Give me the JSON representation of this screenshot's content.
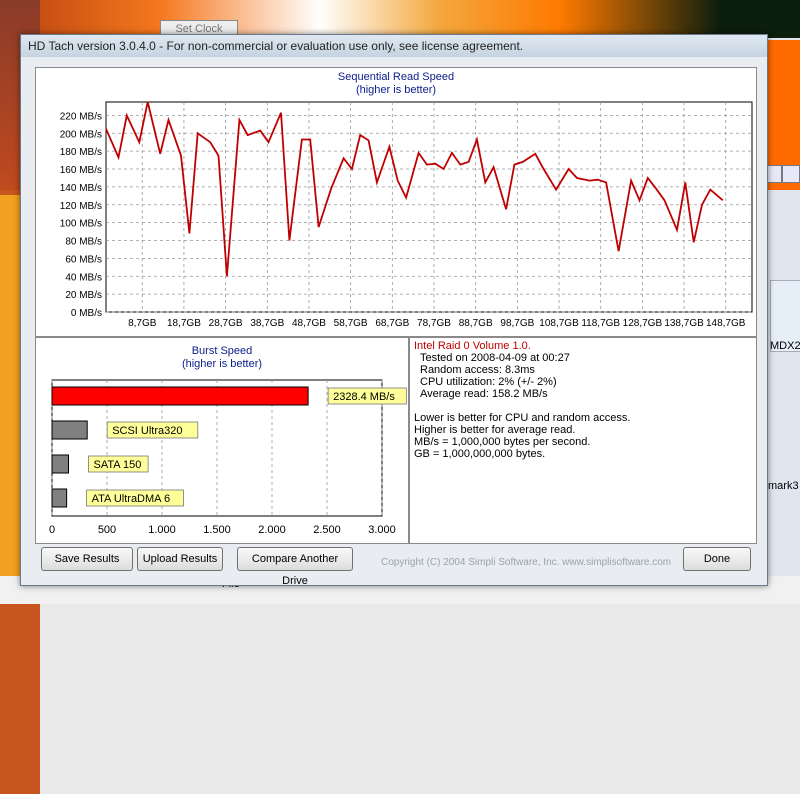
{
  "window": {
    "title": "HD Tach version 3.0.4.0  - For non-commercial or evaluation use only, see license agreement."
  },
  "background": {
    "set_clock_label": "Set Clock",
    "right_label_1": "MDX2",
    "right_label_2": "mark3",
    "bottom_label": "File"
  },
  "chart_data": [
    {
      "type": "line",
      "title": "Sequential Read Speed",
      "subtitle": "(higher is better)",
      "xlabel": "",
      "ylabel": "",
      "ylim": [
        0,
        235
      ],
      "xlim": [
        0,
        155
      ],
      "y_ticks": [
        "0 MB/s",
        "20 MB/s",
        "40 MB/s",
        "60 MB/s",
        "80 MB/s",
        "100 MB/s",
        "120 MB/s",
        "140 MB/s",
        "160 MB/s",
        "180 MB/s",
        "200 MB/s",
        "220 MB/s"
      ],
      "x_ticks": [
        "8,7GB",
        "18,7GB",
        "28,7GB",
        "38,7GB",
        "48,7GB",
        "58,7GB",
        "68,7GB",
        "78,7GB",
        "88,7GB",
        "98,7GB",
        "108,7GB",
        "118,7GB",
        "128,7GB",
        "138,7GB",
        "148,7GB"
      ],
      "grid": true,
      "color": "#c00000",
      "series": [
        {
          "values": [
            [
              0,
              205
            ],
            [
              3,
              173
            ],
            [
              5,
              220
            ],
            [
              8,
              190
            ],
            [
              10,
              235
            ],
            [
              13,
              177
            ],
            [
              15,
              215
            ],
            [
              18,
              175
            ],
            [
              20,
              88
            ],
            [
              22,
              200
            ],
            [
              25,
              190
            ],
            [
              27,
              175
            ],
            [
              29,
              40
            ],
            [
              32,
              215
            ],
            [
              34,
              198
            ],
            [
              37,
              203
            ],
            [
              39,
              190
            ],
            [
              42,
              223
            ],
            [
              44,
              80
            ],
            [
              47,
              193
            ],
            [
              49,
              193
            ],
            [
              51,
              95
            ],
            [
              54,
              138
            ],
            [
              57,
              172
            ],
            [
              59,
              160
            ],
            [
              61,
              198
            ],
            [
              63,
              192
            ],
            [
              65,
              145
            ],
            [
              68,
              185
            ],
            [
              70,
              147
            ],
            [
              72,
              128
            ],
            [
              75,
              178
            ],
            [
              77,
              165
            ],
            [
              79,
              166
            ],
            [
              81,
              160
            ],
            [
              83,
              178
            ],
            [
              85,
              165
            ],
            [
              87,
              168
            ],
            [
              89,
              193
            ],
            [
              91,
              145
            ],
            [
              93,
              162
            ],
            [
              96,
              115
            ],
            [
              98,
              165
            ],
            [
              100,
              168
            ],
            [
              103,
              177
            ],
            [
              105,
              160
            ],
            [
              108,
              137
            ],
            [
              111,
              160
            ],
            [
              113,
              150
            ],
            [
              116,
              147
            ],
            [
              118,
              148
            ],
            [
              120,
              145
            ],
            [
              123,
              68
            ],
            [
              126,
              147
            ],
            [
              128,
              125
            ],
            [
              130,
              150
            ],
            [
              132,
              138
            ],
            [
              134,
              125
            ],
            [
              137,
              92
            ],
            [
              139,
              145
            ],
            [
              141,
              78
            ],
            [
              143,
              120
            ],
            [
              145,
              137
            ],
            [
              148,
              125
            ]
          ]
        }
      ]
    },
    {
      "type": "bar",
      "title": "Burst Speed",
      "subtitle": "(higher is better)",
      "orientation": "horizontal",
      "xlim": [
        0,
        3000
      ],
      "x_ticks": [
        "0",
        "500",
        "1.000",
        "1.500",
        "2.000",
        "2.500",
        "3.000"
      ],
      "grid": true,
      "categories": [
        "2328.4 MB/s",
        "SCSI Ultra320",
        "SATA 150",
        "ATA UltraDMA 6"
      ],
      "values": [
        2328.4,
        320,
        150,
        133
      ],
      "colors": [
        "#ff0000",
        "#808080",
        "#808080",
        "#808080"
      ]
    }
  ],
  "info": {
    "title": "Intel Raid 0 Volume 1.0.",
    "tested_on": "Tested on 2008-04-09 at 00:27",
    "random_access": "Random access: 8.3ms",
    "cpu_util": "CPU utilization: 2% (+/- 2%)",
    "average_read": "Average read: 158.2 MB/s",
    "note1": "Lower is better for CPU and random access.",
    "note2": "Higher is better for average read.",
    "note3": "MB/s = 1,000,000 bytes per second.",
    "note4": "GB = 1,000,000,000 bytes."
  },
  "buttons": {
    "save": "Save Results",
    "upload": "Upload Results",
    "compare": "Compare Another Drive",
    "done": "Done"
  },
  "copyright": "Copyright (C) 2004 Simpli Software, Inc. www.simplisoftware.com"
}
